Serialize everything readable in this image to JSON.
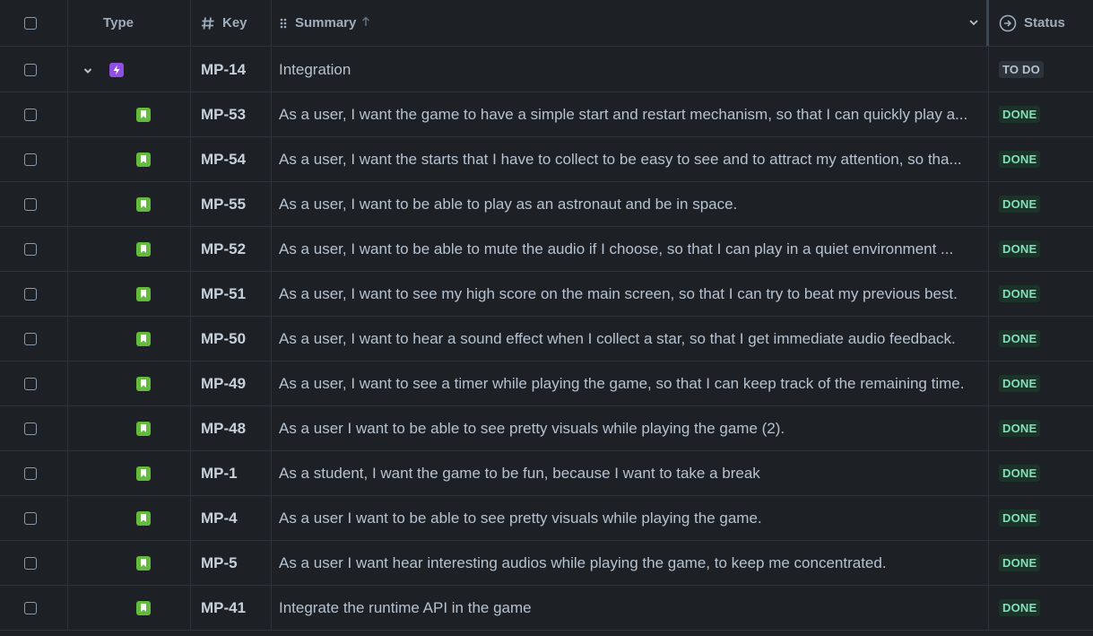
{
  "header": {
    "type_label": "Type",
    "key_label": "Key",
    "summary_label": "Summary",
    "status_label": "Status"
  },
  "rows": [
    {
      "key": "MP-14",
      "summary": "Integration",
      "status": "TO DO",
      "type_icon": "epic-icon"
    },
    {
      "key": "MP-53",
      "summary": "As a user, I want the game to have a simple start and restart mechanism, so that I can quickly play a...",
      "status": "DONE",
      "type_icon": "story-icon"
    },
    {
      "key": "MP-54",
      "summary": "As a user, I want the starts that I have to collect to be easy to see and to attract my attention, so tha...",
      "status": "DONE",
      "type_icon": "story-icon"
    },
    {
      "key": "MP-55",
      "summary": "As a user, I want to be able to play as an astronaut and be in space.",
      "status": "DONE",
      "type_icon": "story-icon"
    },
    {
      "key": "MP-52",
      "summary": "As a user, I want to be able to mute the audio if I choose, so that I can play in a quiet environment ...",
      "status": "DONE",
      "type_icon": "story-icon"
    },
    {
      "key": "MP-51",
      "summary": "As a user, I want to see my high score on the main screen, so that I can try to beat my previous best.",
      "status": "DONE",
      "type_icon": "story-icon"
    },
    {
      "key": "MP-50",
      "summary": "As a user, I want to hear a sound effect when I collect a star, so that I get immediate audio feedback.",
      "status": "DONE",
      "type_icon": "story-icon"
    },
    {
      "key": "MP-49",
      "summary": "As a user, I want to see a timer while playing the game, so that I can keep track of the remaining time.",
      "status": "DONE",
      "type_icon": "story-icon"
    },
    {
      "key": "MP-48",
      "summary": "As a user I want to be able to see pretty visuals while playing the game (2).",
      "status": "DONE",
      "type_icon": "story-icon"
    },
    {
      "key": "MP-1",
      "summary": "As a student, I want the game to be fun, because I want to take a break",
      "status": "DONE",
      "type_icon": "story-icon"
    },
    {
      "key": "MP-4",
      "summary": "As a user I want to be able to see pretty visuals while playing the game.",
      "status": "DONE",
      "type_icon": "story-icon"
    },
    {
      "key": "MP-5",
      "summary": "As a user I want hear interesting audios while playing the game, to keep me concentrated.",
      "status": "DONE",
      "type_icon": "story-icon"
    },
    {
      "key": "MP-41",
      "summary": "Integrate the runtime API in the game",
      "status": "DONE",
      "type_icon": "story-icon"
    }
  ]
}
